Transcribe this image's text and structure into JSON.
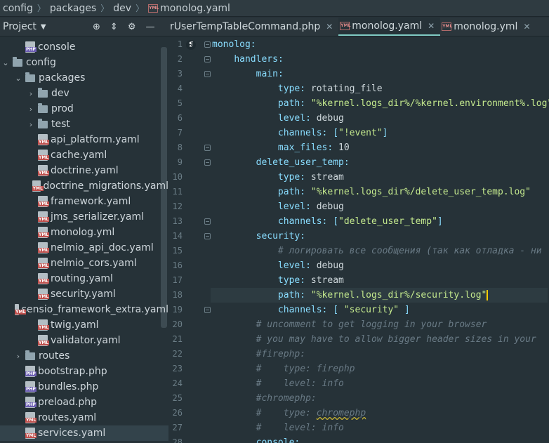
{
  "breadcrumb": [
    "config",
    "packages",
    "dev",
    "monolog.yaml"
  ],
  "project_panel": {
    "title": "Project"
  },
  "tree": [
    {
      "label": "console",
      "type": "php",
      "indent": 1
    },
    {
      "label": "config",
      "type": "folder",
      "arrow": "down",
      "indent": 0
    },
    {
      "label": "packages",
      "type": "folder",
      "arrow": "down",
      "indent": 1
    },
    {
      "label": "dev",
      "type": "folder",
      "arrow": "right",
      "indent": 2
    },
    {
      "label": "prod",
      "type": "folder",
      "arrow": "right",
      "indent": 2
    },
    {
      "label": "test",
      "type": "folder",
      "arrow": "right",
      "indent": 2
    },
    {
      "label": "api_platform.yaml",
      "type": "yml",
      "indent": 2
    },
    {
      "label": "cache.yaml",
      "type": "yml",
      "indent": 2
    },
    {
      "label": "doctrine.yaml",
      "type": "yml",
      "indent": 2
    },
    {
      "label": "doctrine_migrations.yaml",
      "type": "yml",
      "indent": 2
    },
    {
      "label": "framework.yaml",
      "type": "yml",
      "indent": 2
    },
    {
      "label": "jms_serializer.yaml",
      "type": "yml",
      "indent": 2
    },
    {
      "label": "monolog.yml",
      "type": "yml",
      "indent": 2
    },
    {
      "label": "nelmio_api_doc.yaml",
      "type": "yml",
      "indent": 2
    },
    {
      "label": "nelmio_cors.yaml",
      "type": "yml",
      "indent": 2
    },
    {
      "label": "routing.yaml",
      "type": "yml",
      "indent": 2
    },
    {
      "label": "security.yaml",
      "type": "yml",
      "indent": 2
    },
    {
      "label": "sensio_framework_extra.yaml",
      "type": "yml",
      "indent": 2
    },
    {
      "label": "twig.yaml",
      "type": "yml",
      "indent": 2
    },
    {
      "label": "validator.yaml",
      "type": "yml",
      "indent": 2
    },
    {
      "label": "routes",
      "type": "folder",
      "arrow": "right",
      "indent": 1
    },
    {
      "label": "bootstrap.php",
      "type": "php",
      "indent": 1
    },
    {
      "label": "bundles.php",
      "type": "php",
      "indent": 1
    },
    {
      "label": "preload.php",
      "type": "php",
      "indent": 1
    },
    {
      "label": "routes.yaml",
      "type": "yml",
      "indent": 1
    },
    {
      "label": "services.yaml",
      "type": "yml",
      "indent": 1,
      "selected": true
    }
  ],
  "tabs": [
    {
      "label": "rUserTempTableCommand.php",
      "icon": "",
      "active": false
    },
    {
      "label": "monolog.yaml",
      "icon": "yml",
      "active": true
    },
    {
      "label": "monolog.yml",
      "icon": "yml",
      "active": false
    }
  ],
  "code_lines": [
    [
      [
        "k",
        "monolog"
      ],
      [
        "p",
        ":"
      ]
    ],
    [
      [
        "n",
        "    "
      ],
      [
        "k",
        "handlers"
      ],
      [
        "p",
        ":"
      ]
    ],
    [
      [
        "n",
        "        "
      ],
      [
        "k",
        "main"
      ],
      [
        "p",
        ":"
      ]
    ],
    [
      [
        "n",
        "            "
      ],
      [
        "k",
        "type"
      ],
      [
        "p",
        ": "
      ],
      [
        "v",
        "rotating_file"
      ]
    ],
    [
      [
        "n",
        "            "
      ],
      [
        "k",
        "path"
      ],
      [
        "p",
        ": "
      ],
      [
        "s",
        "\"%kernel.logs_dir%/%kernel.environment%.log\""
      ]
    ],
    [
      [
        "n",
        "            "
      ],
      [
        "k",
        "level"
      ],
      [
        "p",
        ": "
      ],
      [
        "v",
        "debug"
      ]
    ],
    [
      [
        "n",
        "            "
      ],
      [
        "k",
        "channels"
      ],
      [
        "p",
        ": "
      ],
      [
        "b",
        "["
      ],
      [
        "s",
        "\"!event\""
      ],
      [
        "b",
        "]"
      ]
    ],
    [
      [
        "n",
        "            "
      ],
      [
        "k",
        "max_files"
      ],
      [
        "p",
        ": "
      ],
      [
        "v",
        "10"
      ]
    ],
    [
      [
        "n",
        "        "
      ],
      [
        "k",
        "delete_user_temp"
      ],
      [
        "p",
        ":"
      ]
    ],
    [
      [
        "n",
        "            "
      ],
      [
        "k",
        "type"
      ],
      [
        "p",
        ": "
      ],
      [
        "v",
        "stream"
      ]
    ],
    [
      [
        "n",
        "            "
      ],
      [
        "k",
        "path"
      ],
      [
        "p",
        ": "
      ],
      [
        "s",
        "\"%kernel.logs_dir%/delete_user_temp.log\""
      ]
    ],
    [
      [
        "n",
        "            "
      ],
      [
        "k",
        "level"
      ],
      [
        "p",
        ": "
      ],
      [
        "v",
        "debug"
      ]
    ],
    [
      [
        "n",
        "            "
      ],
      [
        "k",
        "channels"
      ],
      [
        "p",
        ": "
      ],
      [
        "b",
        "["
      ],
      [
        "s",
        "\"delete_user_temp\""
      ],
      [
        "b",
        "]"
      ]
    ],
    [
      [
        "n",
        "        "
      ],
      [
        "k",
        "security"
      ],
      [
        "p",
        ":"
      ]
    ],
    [
      [
        "n",
        "            "
      ],
      [
        "c",
        "# логировать все сообщения (так как отладка - ни"
      ]
    ],
    [
      [
        "n",
        "            "
      ],
      [
        "k",
        "level"
      ],
      [
        "p",
        ": "
      ],
      [
        "v",
        "debug"
      ]
    ],
    [
      [
        "n",
        "            "
      ],
      [
        "k",
        "type"
      ],
      [
        "p",
        ": "
      ],
      [
        "v",
        "stream"
      ]
    ],
    [
      [
        "n",
        "            "
      ],
      [
        "k",
        "path"
      ],
      [
        "p",
        ": "
      ],
      [
        "s",
        "\"%kernel.logs_dir%/security.log\""
      ],
      [
        "caret",
        ""
      ]
    ],
    [
      [
        "n",
        "            "
      ],
      [
        "k",
        "channels"
      ],
      [
        "p",
        ": "
      ],
      [
        "b",
        "[ "
      ],
      [
        "s",
        "\"security\""
      ],
      [
        "b",
        " ]"
      ]
    ],
    [
      [
        "n",
        "        "
      ],
      [
        "c",
        "# uncomment to get logging in your browser"
      ]
    ],
    [
      [
        "n",
        "        "
      ],
      [
        "c",
        "# you may have to allow bigger header sizes in your"
      ]
    ],
    [
      [
        "n",
        "        "
      ],
      [
        "c",
        "#firephp:"
      ]
    ],
    [
      [
        "n",
        "        "
      ],
      [
        "c",
        "#    type: firephp"
      ]
    ],
    [
      [
        "n",
        "        "
      ],
      [
        "c",
        "#    level: info"
      ]
    ],
    [
      [
        "n",
        "        "
      ],
      [
        "c",
        "#chromephp:"
      ]
    ],
    [
      [
        "n",
        "        "
      ],
      [
        "c",
        "#    type: "
      ],
      [
        "cs",
        "chromephp"
      ]
    ],
    [
      [
        "n",
        "        "
      ],
      [
        "c",
        "#    level: info"
      ]
    ],
    [
      [
        "n",
        "        "
      ],
      [
        "k",
        "console"
      ],
      [
        "p",
        ":"
      ]
    ]
  ],
  "line_numbers": [
    "1",
    "2",
    "3",
    "4",
    "5",
    "6",
    "7",
    "8",
    "9",
    "10",
    "11",
    "12",
    "13",
    "14",
    "15",
    "16",
    "17",
    "18",
    "19",
    "20",
    "21",
    "22",
    "23",
    "24",
    "25",
    "26",
    "27",
    "28"
  ],
  "current_line": 18
}
